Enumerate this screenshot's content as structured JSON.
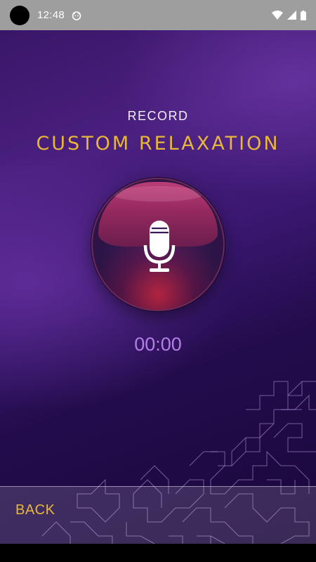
{
  "status_bar": {
    "time": "12:48",
    "icons": [
      "avatar-dot",
      "app-notification-icon",
      "wifi-icon",
      "signal-icon",
      "battery-icon"
    ]
  },
  "header": {
    "subtitle": "RECORD",
    "title": "CUSTOM RELAXATION"
  },
  "recorder": {
    "icon": "microphone-icon",
    "timer": "00:00"
  },
  "footer": {
    "back_label": "BACK"
  },
  "colors": {
    "accent_gold": "#e8b63a",
    "timer_purple": "#b47ee8",
    "background_purple": "#3a1668"
  }
}
